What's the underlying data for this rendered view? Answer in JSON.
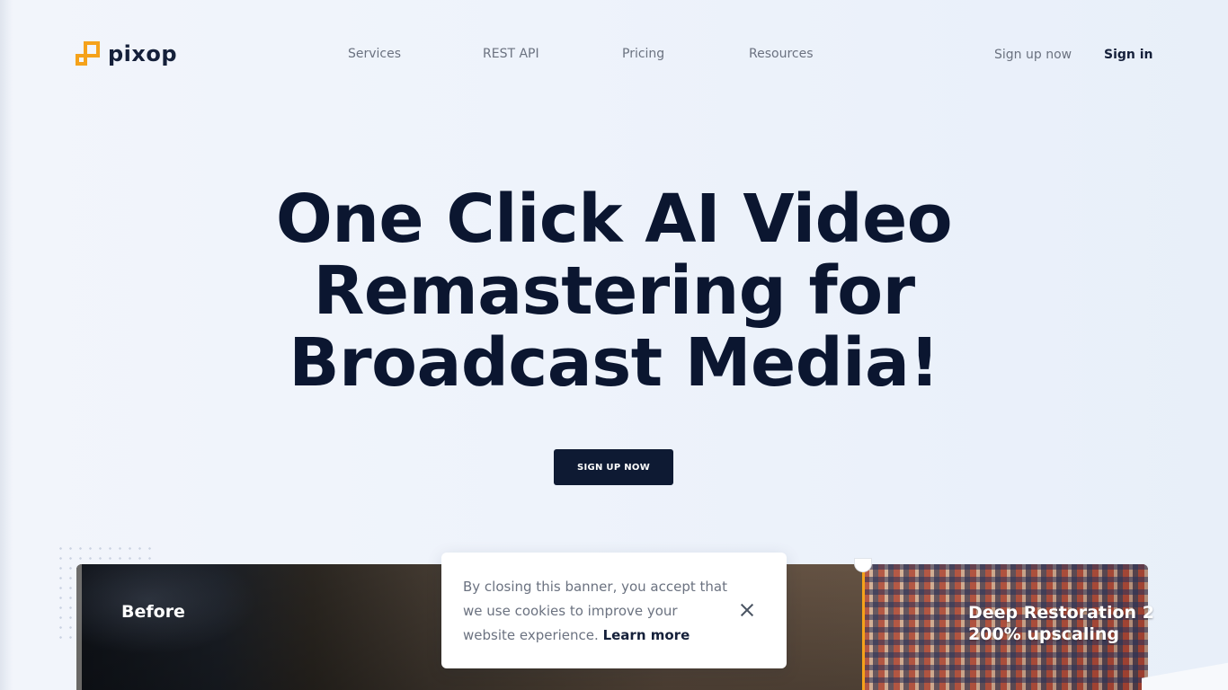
{
  "brand": {
    "name": "pixop",
    "accent": "#f5a21a",
    "dark": "#0e1a33"
  },
  "nav": {
    "links": [
      "Services",
      "REST API",
      "Pricing",
      "Resources"
    ],
    "signup": "Sign up now",
    "signin": "Sign in"
  },
  "hero": {
    "title_line1": "One Click AI Video",
    "title_line2": "Remastering for",
    "title_line3": "Broadcast Media!",
    "cta": "SIGN UP NOW"
  },
  "compare": {
    "before_label": "Before",
    "after_label_line1": "Deep Restoration 2",
    "after_label_line2": "200% upscaling"
  },
  "cookie": {
    "text": "By closing this banner, you accept that we use cookies to improve your website experience.",
    "link": "Learn more"
  }
}
